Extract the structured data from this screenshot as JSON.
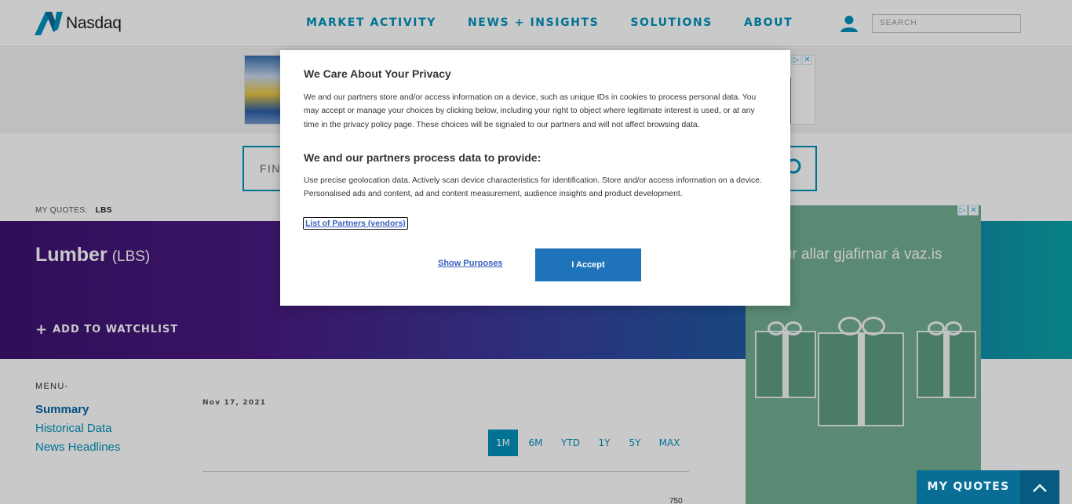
{
  "header": {
    "logo_text": "Nasdaq",
    "nav": [
      "MARKET ACTIVITY",
      "NEWS + INSIGHTS",
      "SOLUTIONS",
      "ABOUT"
    ],
    "search_placeholder": "SEARCH"
  },
  "quote_search": {
    "placeholder": "FIN"
  },
  "my_quotes": {
    "label": "MY QUOTES:",
    "symbol": "LBS"
  },
  "hero": {
    "name": "Lumber",
    "symbol": "(LBS)",
    "watchlist": "ADD TO WATCHLIST"
  },
  "menu": {
    "heading": "MENU-",
    "items": [
      "Summary",
      "Historical Data",
      "News Headlines"
    ]
  },
  "chart": {
    "date": "Nov 17, 2021",
    "ranges": [
      "1M",
      "6M",
      "YTD",
      "1Y",
      "5Y",
      "MAX"
    ],
    "selected_range": "1M",
    "axis_top_value": "750"
  },
  "ad_right": {
    "text": "mur allar gjafirnar á vaz.is"
  },
  "sticky": {
    "label": "MY QUOTES"
  },
  "privacy": {
    "title": "We Care About Your Privacy",
    "body": "We and our partners store and/or access information on a device, such as unique IDs in cookies to process personal data. You may accept or manage your choices by clicking below, including your right to object where legitimate interest is used, or at any time in the privacy policy page. These choices will be signaled to our partners and will not affect browsing data.",
    "subtitle": "We and our partners process data to provide:",
    "purposes": "Use precise geolocation data. Actively scan device characteristics for identification. Store and/or access information on a device. Personalised ads and content, ad and content measurement, audience insights and product development.",
    "vendors_link": "List of Partners (vendors)",
    "show_purposes": "Show Purposes",
    "accept": "I Accept"
  },
  "colors": {
    "brand": "#0092bc",
    "accept": "#1f74b9",
    "ad_green": "#73ae94"
  },
  "icons": {
    "user": "user-icon",
    "search": "search-icon",
    "plus": "plus-icon",
    "chevron": "chevron-up-icon",
    "adchoices": "adchoices-icon",
    "close": "close-icon"
  }
}
